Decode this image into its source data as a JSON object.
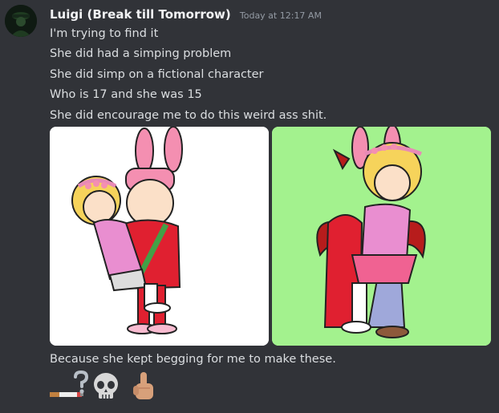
{
  "message": {
    "author": "Luigi (Break till Tomorrow)",
    "timestamp": "Today at 12:17 AM",
    "lines": [
      "I'm trying to find it",
      "She did had a simping problem",
      "She did simp on a fictional character",
      "Who is 17 and she was 15",
      "She did encourage me to do this weird ass shit."
    ],
    "attachments": [
      {
        "icon": "cartoon-couple-illustration",
        "background": "#ffffff"
      },
      {
        "icon": "cartoon-couple-illustration-green",
        "background": "#a3f28e"
      }
    ],
    "after_text": "Because she kept begging for me to make these.",
    "emojis": [
      "cigarette-emoji",
      "question-mark-emoji",
      "skull-emoji",
      "middle-finger-emoji"
    ]
  },
  "colors": {
    "background": "#313338",
    "text": "#dbdee1",
    "username": "#f2f3f5",
    "timestamp": "#949ba4"
  }
}
